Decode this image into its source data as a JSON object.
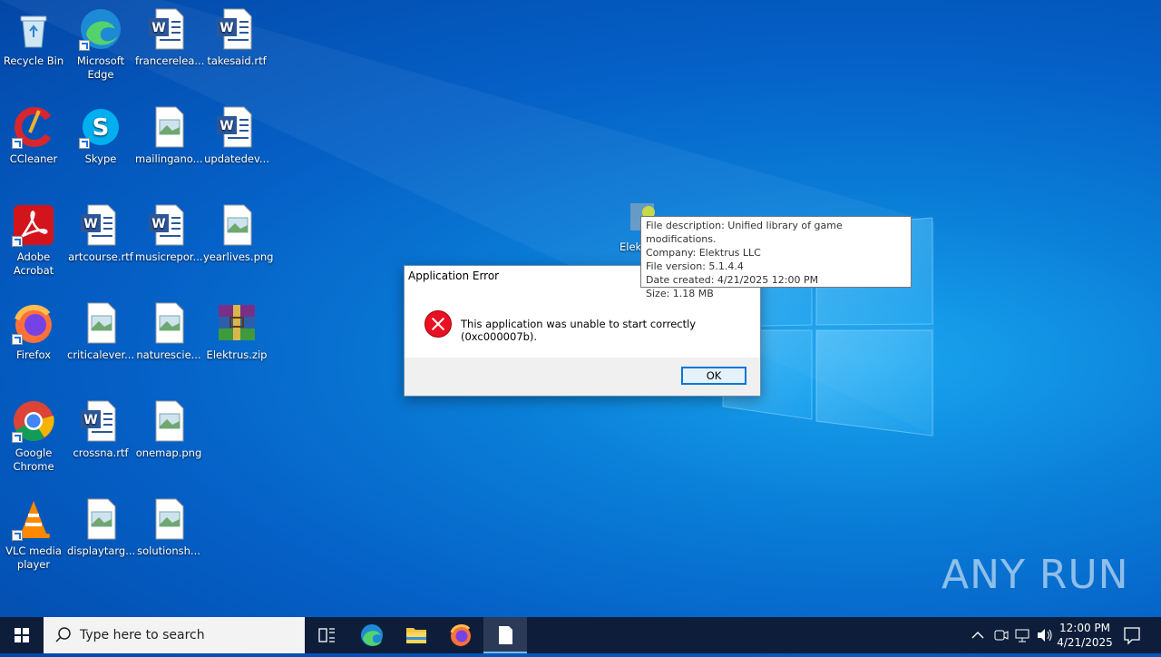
{
  "desktop": {
    "icons": [
      {
        "label": "Recycle Bin",
        "icon": "recycle-bin-icon"
      },
      {
        "label": "Microsoft Edge",
        "icon": "edge-icon"
      },
      {
        "label": "francerelea...",
        "icon": "word-doc-icon"
      },
      {
        "label": "takesaid.rtf",
        "icon": "word-doc-icon"
      },
      {
        "label": "CCleaner",
        "icon": "ccleaner-icon"
      },
      {
        "label": "Skype",
        "icon": "skype-icon"
      },
      {
        "label": "mailingano...",
        "icon": "image-file-icon"
      },
      {
        "label": "updatedev...",
        "icon": "word-doc-icon"
      },
      {
        "label": "Adobe Acrobat",
        "icon": "acrobat-icon"
      },
      {
        "label": "artcourse.rtf",
        "icon": "word-doc-icon"
      },
      {
        "label": "musicrepor...",
        "icon": "word-doc-icon"
      },
      {
        "label": "yearlives.png",
        "icon": "image-file-icon"
      },
      {
        "label": "Firefox",
        "icon": "firefox-icon"
      },
      {
        "label": "criticalever...",
        "icon": "image-file-icon"
      },
      {
        "label": "naturescie...",
        "icon": "image-file-icon"
      },
      {
        "label": "Elektrus.zip",
        "icon": "winrar-archive-icon"
      },
      {
        "label": "Google Chrome",
        "icon": "chrome-icon"
      },
      {
        "label": "crossna.rtf",
        "icon": "word-doc-icon"
      },
      {
        "label": "onemap.png",
        "icon": "image-file-icon"
      },
      {
        "label": "VLC media player",
        "icon": "vlc-icon"
      },
      {
        "label": "displaytarg...",
        "icon": "image-file-icon"
      },
      {
        "label": "solutionsh...",
        "icon": "image-file-icon"
      }
    ],
    "partial_icon_label": "Elekt"
  },
  "dialog": {
    "title": "Application Error",
    "message": "This application was unable to start correctly (0xc000007b).",
    "ok_label": "OK"
  },
  "tooltip": {
    "line1": "File description: Unified library of game modifications.",
    "line2": "Company: Elektrus LLC",
    "line3": "File version: 5.1.4.4",
    "line4": "Date created: 4/21/2025 12:00 PM",
    "line5": "Size: 1.18 MB"
  },
  "watermark": "ANY RUN",
  "taskbar": {
    "search_placeholder": "Type here to search",
    "clock_time": "12:00 PM",
    "clock_date": "4/21/2025"
  }
}
